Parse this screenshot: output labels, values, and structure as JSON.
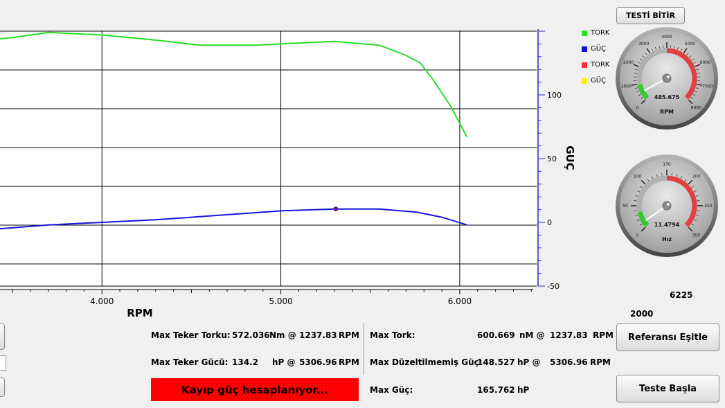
{
  "buttons": {
    "end_test": "TESTİ BİTİR",
    "match_reference": "Referansı Eşitle",
    "start_test": "Teste Başla"
  },
  "chart_data": {
    "type": "line",
    "xlabel": "RPM",
    "ylabel": "GÜÇ",
    "x_ticks": [
      "4.000",
      "5.000",
      "6.000"
    ],
    "x_range": [
      3430,
      6430
    ],
    "y_ticks": [
      "100",
      "50",
      "0",
      "-50"
    ],
    "y_range": [
      -50,
      150
    ],
    "grid": true,
    "series": [
      {
        "name": "TORK",
        "color": "#22e022",
        "x": [
          3430,
          3500,
          3700,
          4000,
          4300,
          4550,
          4850,
          5000,
          5300,
          5550,
          5700,
          5780,
          5850,
          5950,
          6040
        ],
        "y": [
          144,
          145,
          149,
          147,
          143,
          139,
          139,
          140,
          142,
          139,
          131,
          125,
          112,
          91,
          67
        ]
      },
      {
        "name": "GÜÇ",
        "color": "#1515d8",
        "x": [
          3430,
          3700,
          4000,
          4300,
          4600,
          4900,
          5000,
          5300,
          5550,
          5760,
          5900,
          6040
        ],
        "y": [
          -5,
          -2,
          0,
          2,
          5,
          8,
          9,
          10.5,
          10.5,
          8,
          4,
          -2
        ]
      }
    ],
    "marker": {
      "x": 5307,
      "y": 10.5,
      "color": "#6a1a8a"
    }
  },
  "legend": [
    {
      "label": "TORK",
      "color": "#22e622"
    },
    {
      "label": "GÜÇ",
      "color": "#1010e0"
    },
    {
      "label": "TORK",
      "color": "#ff3030"
    },
    {
      "label": "GÜÇ",
      "color": "#f4f400"
    }
  ],
  "rpm_gauge": {
    "value": "485.675",
    "unit": "RPM",
    "needle_value": 485.675,
    "min": 0,
    "max": 8000,
    "ticks": [
      "0",
      "1000",
      "2000",
      "3000",
      "4000",
      "5000",
      "6000",
      "7000",
      "8000"
    ]
  },
  "speed_gauge": {
    "value": "11.4794",
    "unit": "Hız",
    "needle_value": 11.4794,
    "min": 0,
    "max": 300,
    "ticks": [
      "0",
      "50",
      "100",
      "150",
      "200",
      "250",
      "300"
    ]
  },
  "side_values": {
    "rpm_extra": "6225",
    "speed_extra": "2000"
  },
  "stats_left": {
    "max_wheel_torque_label": "Max Teker Torku:",
    "max_wheel_torque_value": "572.036",
    "max_wheel_torque_unit": "Nm @",
    "max_wheel_torque_rpm": "1237.83",
    "max_wheel_torque_rpm_unit": "RPM",
    "max_wheel_power_label": "Max Teker Gücü:",
    "max_wheel_power_value": "134.2",
    "max_wheel_power_unit": "hP @",
    "max_wheel_power_rpm": "5306.96",
    "max_wheel_power_rpm_unit": "RPM"
  },
  "stats_right": {
    "max_torque_label": "Max Tork:",
    "max_torque_value": "600.669",
    "max_torque_unit": "nM @",
    "max_torque_rpm": "1237.83",
    "max_torque_rpm_unit": "RPM",
    "max_uncorrected_power_label": "Max Düzeltilmemiş Güç:",
    "max_uncorrected_power_value": "148.527",
    "max_uncorrected_power_unit": "hP @",
    "max_uncorrected_power_rpm": "5306.96",
    "max_uncorrected_power_rpm_unit": "RPM",
    "max_power_label": "Max Güç:",
    "max_power_value": "165.762",
    "max_power_unit": "hP"
  },
  "status": "Kayıp güç hesaplanıyor..."
}
